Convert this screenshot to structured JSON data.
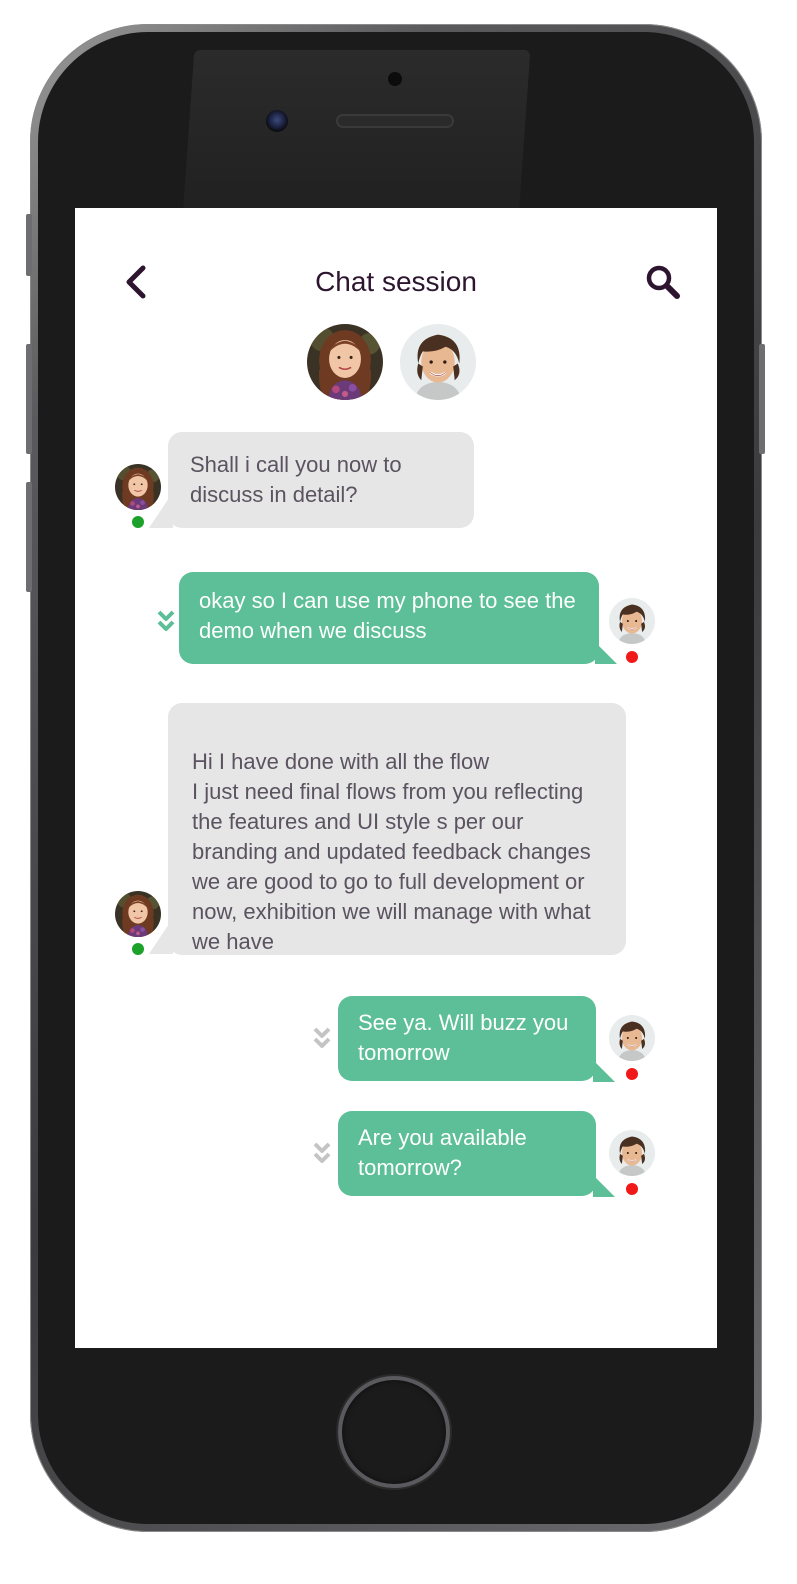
{
  "header": {
    "title": "Chat session"
  },
  "colors": {
    "incoming_bubble": "#e6e6e6",
    "outgoing_bubble": "#5cbf97",
    "online": "#1ca12b",
    "offline": "#f01818",
    "title_text": "#2d1530"
  },
  "icons": {
    "back": "chevron-left-icon",
    "search": "search-icon",
    "read_receipt": "double-chevron-down-icon"
  },
  "participants": [
    {
      "avatar": "woman-avatar",
      "status": "online"
    },
    {
      "avatar": "man-avatar",
      "status": "offline"
    }
  ],
  "messages": [
    {
      "direction": "incoming",
      "text": "Shall i call you now to discuss in detail?"
    },
    {
      "direction": "outgoing",
      "text": "okay so I can use my phone to see the demo when we discuss",
      "receipt": "read"
    },
    {
      "direction": "incoming",
      "text": "Hi I have done with all the flow\nI just need final flows from you reflecting the features and UI style s per our branding and updated feedback changes we are good to go to full development or now, exhibition we will manage with what we have"
    },
    {
      "direction": "outgoing",
      "text": "See ya. Will buzz you tomorrow",
      "receipt": "delivered"
    },
    {
      "direction": "outgoing",
      "text": "Are you available tomorrow?",
      "receipt": "delivered"
    }
  ]
}
